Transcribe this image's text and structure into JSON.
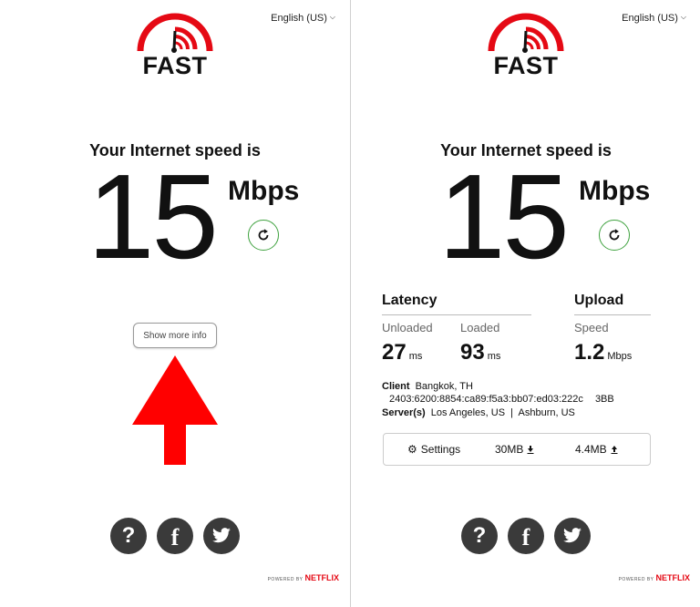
{
  "left": {
    "language": "English (US)",
    "logo_text": "FAST",
    "speed_label": "Your Internet speed is",
    "speed_value": "15",
    "speed_unit": "Mbps",
    "show_more_label": "Show more info",
    "powered_by": "POWERED BY",
    "netflix": "NETFLIX"
  },
  "right": {
    "language": "English (US)",
    "logo_text": "FAST",
    "speed_label": "Your Internet speed is",
    "speed_value": "15",
    "speed_unit": "Mbps",
    "latency": {
      "title": "Latency",
      "unloaded_label": "Unloaded",
      "unloaded_value": "27",
      "unloaded_unit": "ms",
      "loaded_label": "Loaded",
      "loaded_value": "93",
      "loaded_unit": "ms"
    },
    "upload": {
      "title": "Upload",
      "speed_label": "Speed",
      "speed_value": "1.2",
      "speed_unit": "Mbps"
    },
    "client": {
      "label": "Client",
      "location": "Bangkok, TH",
      "address": "2403:6200:8854:ca89:f5a3:bb07:ed03:222c",
      "isp": "3BB"
    },
    "servers": {
      "label": "Server(s)",
      "list": "Los Angeles, US  |  Ashburn, US"
    },
    "settings_bar": {
      "settings_label": "Settings",
      "download_size": "30MB",
      "upload_size": "4.4MB"
    },
    "powered_by": "POWERED BY",
    "netflix": "NETFLIX"
  },
  "colors": {
    "brand_red": "#e50914",
    "refresh_green": "#3fa23f",
    "annotation_arrow": "#ff0000",
    "social_bg": "#3a3a3a"
  },
  "icons": [
    "speedometer-logo-icon",
    "refresh-icon",
    "chevron-down-icon",
    "question-icon",
    "facebook-icon",
    "twitter-icon",
    "gear-icon",
    "download-icon",
    "upload-icon",
    "red-arrow-annotation"
  ]
}
